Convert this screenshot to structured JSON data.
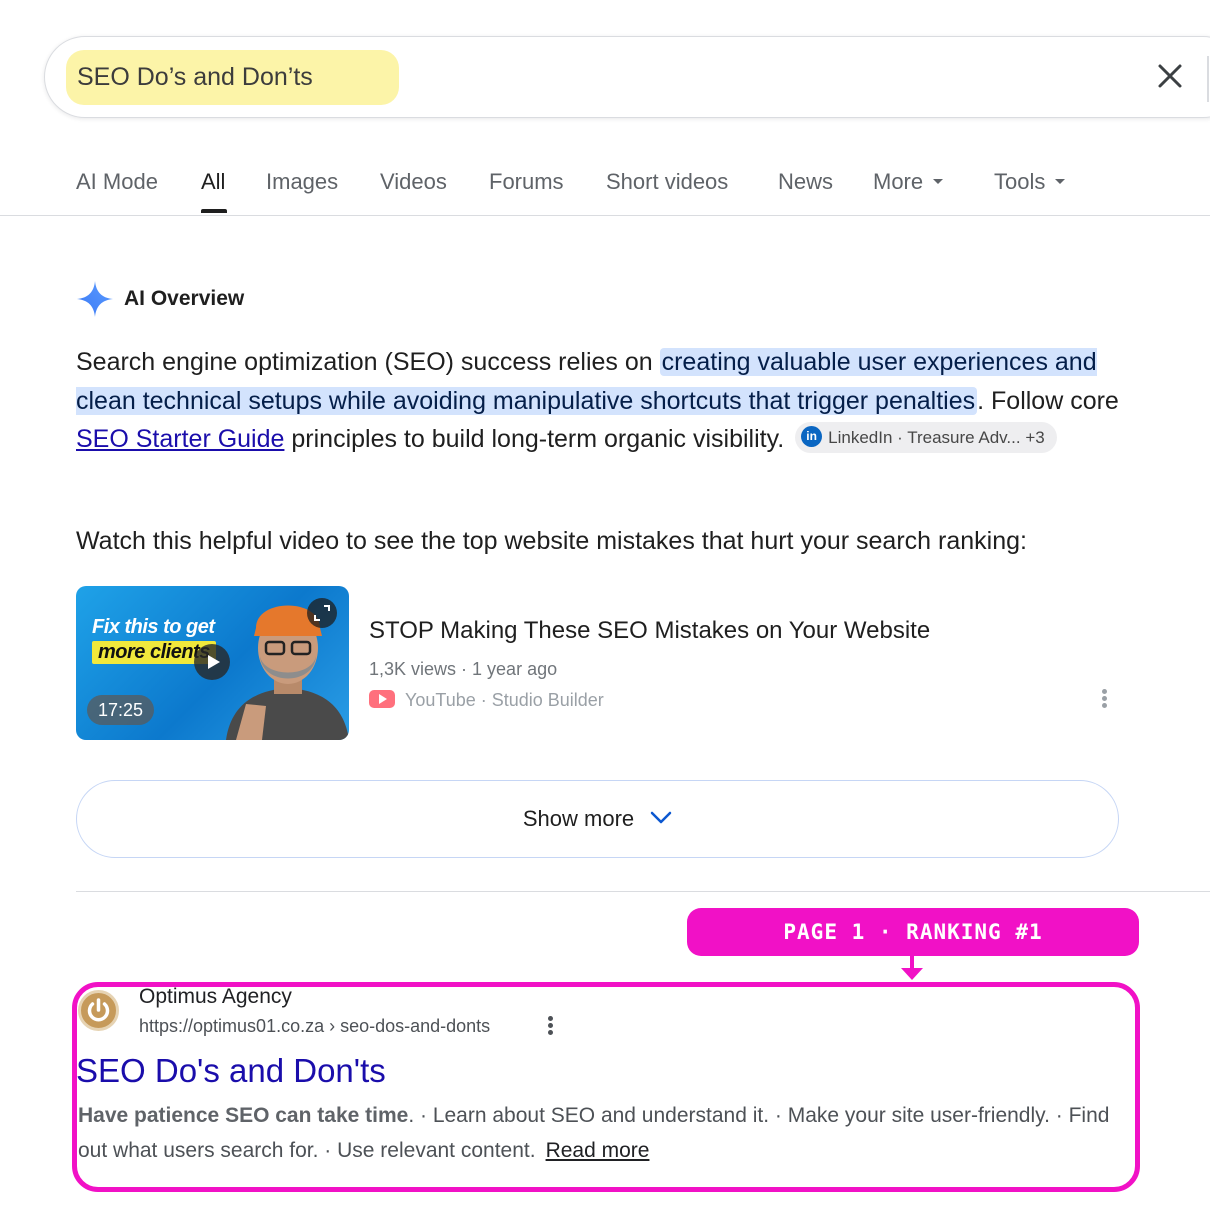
{
  "search": {
    "query": "SEO Do’s and Don’ts"
  },
  "tabs": [
    {
      "label": "AI Mode"
    },
    {
      "label": "All"
    },
    {
      "label": "Images"
    },
    {
      "label": "Videos"
    },
    {
      "label": "Forums"
    },
    {
      "label": "Short videos"
    },
    {
      "label": "News"
    },
    {
      "label": "More"
    },
    {
      "label": "Tools"
    }
  ],
  "ai_overview": {
    "title": "AI Overview",
    "para_start": "Search engine optimization (SEO) success relies on ",
    "para_highlight": "creating valuable user experiences and clean technical setups while avoiding manipulative shortcuts that trigger penalties",
    "para_mid": ". Follow core ",
    "link_text": "SEO Starter Guide",
    "para_end": " principles to build long-term organic visibility.",
    "chip_label": "LinkedIn · Treasure Adv...",
    "chip_more": "+3",
    "chip_icon": "in",
    "watch_text": "Watch this helpful video to see the top website mistakes that hurt your search ranking:",
    "video": {
      "thumb_line1": "Fix this to get",
      "thumb_line2": "more clients",
      "duration": "17:25",
      "title": "STOP Making These SEO Mistakes on Your Website",
      "meta": "1,3K views · 1 year ago",
      "source": "YouTube · Studio Builder"
    },
    "show_more": "Show more"
  },
  "annotation": {
    "badge_text": "PAGE 1 · RANKING #1",
    "color": "#f111c6"
  },
  "result": {
    "site_name": "Optimus Agency",
    "url": "https://optimus01.co.za › seo-dos-and-donts",
    "title": "SEO Do's and Don'ts",
    "snippet_bold": "Have patience SEO can take time",
    "snippet_rest": ". · Learn about SEO and understand it. · Make your site user-friendly. · Find out what users search for. · Use relevant content.",
    "read_more": "Read more"
  },
  "colors": {
    "link_blue": "#1a0dab",
    "ai_highlight": "#d3e3fd",
    "query_highlight": "#fcf4a8"
  }
}
